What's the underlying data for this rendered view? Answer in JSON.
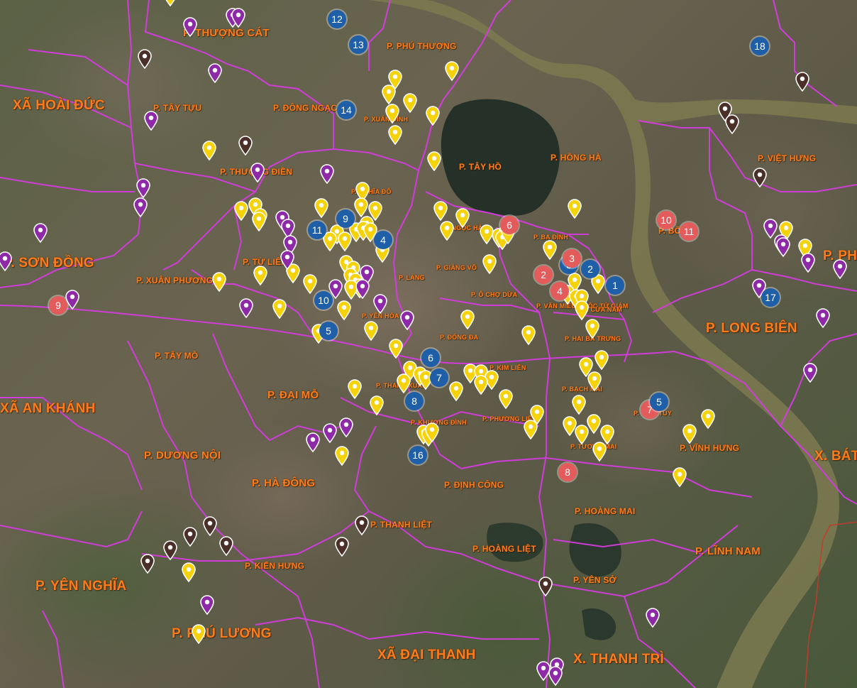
{
  "colors": {
    "boundary": "#d63be0",
    "river": "#7a7a4e",
    "lake": "#263129",
    "label": "#ff7a1a",
    "cluster_blue": "#1f5fa8",
    "cluster_red": "#e35b5b",
    "pin_yellow": "#f5d20a",
    "pin_purple": "#8e2aa8",
    "pin_brown": "#4a3028"
  },
  "labels": [
    {
      "text": "P. THƯỢNG CÁT",
      "size": "m"
    },
    {
      "text": "XÃ HOÀI ĐỨC",
      "size": "l"
    },
    {
      "text": "P. TÂY TỰU",
      "size": "s"
    },
    {
      "text": "P. ĐÔNG NGẠC",
      "size": "s"
    },
    {
      "text": "P. PHÚ THƯỢNG",
      "size": "s"
    },
    {
      "text": "P. XUÂN ĐỈNH",
      "size": "xs"
    },
    {
      "text": "P. TÂY HỒ",
      "size": "s"
    },
    {
      "text": "P. HỒNG HÀ",
      "size": "s"
    },
    {
      "text": "P. VIỆT HƯNG",
      "size": "s"
    },
    {
      "text": "P. BỒ ĐỀ",
      "size": "s"
    },
    {
      "text": "P. PHÚC",
      "size": "l"
    },
    {
      "text": "P. THƯỢNG ĐIỀN",
      "size": "s"
    },
    {
      "text": "P. NGHĨA ĐÔ",
      "size": "xs"
    },
    {
      "text": "P. SƠN ĐỒNG",
      "size": "l"
    },
    {
      "text": "P. TỪ LIÊM",
      "size": "s"
    },
    {
      "text": "P. XUÂN PHƯƠNG",
      "size": "s"
    },
    {
      "text": "P. LÁNG",
      "size": "xs"
    },
    {
      "text": "P. GIẢNG VÕ",
      "size": "xs"
    },
    {
      "text": "P. BA ĐÌNH",
      "size": "xs"
    },
    {
      "text": "P. NGỌC HÀ",
      "size": "xs"
    },
    {
      "text": "P. Ô CHỢ DỪA",
      "size": "xs"
    },
    {
      "text": "P. VĂN MIẾU QUỐC TỬ GIÁM",
      "size": "xs"
    },
    {
      "text": "P. CỬA NAM",
      "size": "xs"
    },
    {
      "text": "P. HAI BÀ TRƯNG",
      "size": "xs"
    },
    {
      "text": "P. LONG BIÊN",
      "size": "l"
    },
    {
      "text": "P. YÊN HÒA",
      "size": "xs"
    },
    {
      "text": "P. TÂY MỖ",
      "size": "s"
    },
    {
      "text": "P. ĐỐNG ĐA",
      "size": "xs"
    },
    {
      "text": "P. KIM LIÊN",
      "size": "xs"
    },
    {
      "text": "P. BẠCH MAI",
      "size": "xs"
    },
    {
      "text": "XÃ AN KHÁNH",
      "size": "l"
    },
    {
      "text": "P. ĐẠI MỖ",
      "size": "m"
    },
    {
      "text": "P. THANH XUÂN",
      "size": "xs"
    },
    {
      "text": "P. KHƯƠNG ĐÌNH",
      "size": "xs"
    },
    {
      "text": "P. PHƯƠNG LIỆT",
      "size": "xs"
    },
    {
      "text": "P. TƯƠNG MAI",
      "size": "xs"
    },
    {
      "text": "P. VĨNH TUY",
      "size": "xs"
    },
    {
      "text": "P. VĨNH HƯNG",
      "size": "s"
    },
    {
      "text": "X. BÁT",
      "size": "l"
    },
    {
      "text": "P. DƯƠNG NỘI",
      "size": "m"
    },
    {
      "text": "P. HÀ ĐÔNG",
      "size": "m"
    },
    {
      "text": "P. ĐỊNH CÔNG",
      "size": "s"
    },
    {
      "text": "P. HOÀNG MAI",
      "size": "s"
    },
    {
      "text": "P. THANH LIỆT",
      "size": "s"
    },
    {
      "text": "P. HOÀNG LIỆT",
      "size": "s"
    },
    {
      "text": "P. LĨNH NAM",
      "size": "m"
    },
    {
      "text": "P. KIẾN HƯNG",
      "size": "s"
    },
    {
      "text": "P. YÊN SỞ",
      "size": "s"
    },
    {
      "text": "P. YÊN NGHĨA",
      "size": "l"
    },
    {
      "text": "P. PHÚ LƯƠNG",
      "size": "l"
    },
    {
      "text": "XÃ ĐẠI THANH",
      "size": "l"
    },
    {
      "text": "X. THANH TRÌ",
      "size": "l"
    }
  ],
  "clusters": [
    {
      "label": "12",
      "color": "blue"
    },
    {
      "label": "13",
      "color": "blue"
    },
    {
      "label": "14",
      "color": "blue"
    },
    {
      "label": "18",
      "color": "blue"
    },
    {
      "label": "9",
      "color": "blue"
    },
    {
      "label": "11",
      "color": "blue"
    },
    {
      "label": "4",
      "color": "blue"
    },
    {
      "label": "10",
      "color": "blue"
    },
    {
      "label": "5",
      "color": "blue"
    },
    {
      "label": "3",
      "color": "blue"
    },
    {
      "label": "2",
      "color": "blue"
    },
    {
      "label": "1",
      "color": "blue"
    },
    {
      "label": "6",
      "color": "blue"
    },
    {
      "label": "7",
      "color": "blue"
    },
    {
      "label": "8",
      "color": "blue"
    },
    {
      "label": "16",
      "color": "blue"
    },
    {
      "label": "17",
      "color": "blue"
    },
    {
      "label": "6",
      "color": "red"
    },
    {
      "label": "3",
      "color": "red"
    },
    {
      "label": "2",
      "color": "red"
    },
    {
      "label": "4",
      "color": "red"
    },
    {
      "label": "9",
      "color": "red"
    },
    {
      "label": "10",
      "color": "red"
    },
    {
      "label": "11",
      "color": "red"
    },
    {
      "label": "7",
      "color": "red"
    },
    {
      "label": "8",
      "color": "red"
    },
    {
      "label": "5",
      "color": "blue"
    }
  ],
  "pins": {
    "yellow_count": 110,
    "purple_count": 38,
    "brown_count": 14
  }
}
